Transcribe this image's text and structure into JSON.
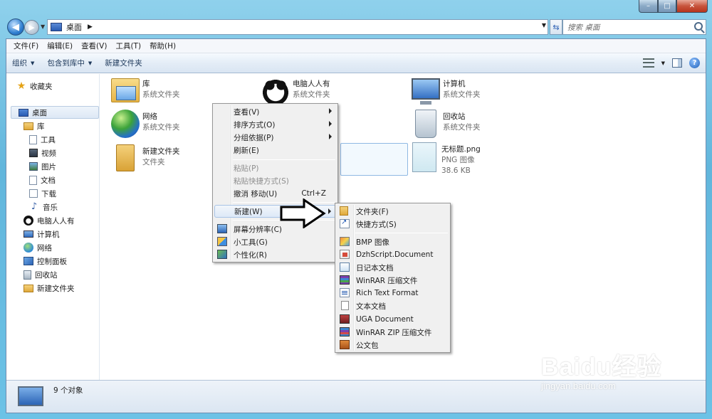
{
  "window": {
    "caption_buttons": {
      "min": "–",
      "max": "□",
      "close": "✕"
    }
  },
  "address": {
    "path": "桌面",
    "search_placeholder": "搜索 桌面"
  },
  "menubar": [
    "文件(F)",
    "编辑(E)",
    "查看(V)",
    "工具(T)",
    "帮助(H)"
  ],
  "toolbar": {
    "organize": "组织",
    "include": "包含到库中",
    "new_folder": "新建文件夹"
  },
  "navpane": {
    "favorites": "收藏夹",
    "desktop": "桌面",
    "library": "库",
    "tools": "工具",
    "video": "视频",
    "pictures": "图片",
    "documents": "文档",
    "downloads": "下载",
    "music": "音乐",
    "user": "电脑人人有",
    "computer": "计算机",
    "network": "网络",
    "control_panel": "控制面板",
    "recycle_bin": "回收站",
    "new_folder": "新建文件夹"
  },
  "items": {
    "library": {
      "name": "库",
      "type": "系统文件夹"
    },
    "user": {
      "name": "电脑人人有",
      "type": "系统文件夹"
    },
    "computer": {
      "name": "计算机",
      "type": "系统文件夹"
    },
    "network": {
      "name": "网络",
      "type": "系统文件夹"
    },
    "recycle": {
      "name": "回收站",
      "type": "系统文件夹"
    },
    "newfolder": {
      "name": "新建文件夹",
      "type": "文件夹"
    },
    "png": {
      "name": "无标题.png",
      "type": "PNG 图像",
      "size": "38.6 KB"
    }
  },
  "status": {
    "count": "9 个对象"
  },
  "context_menu": {
    "view": "查看(V)",
    "sort": "排序方式(O)",
    "group": "分组依据(P)",
    "refresh": "刷新(E)",
    "paste": "粘贴(P)",
    "paste_shortcut": "粘贴快捷方式(S)",
    "undo": "撤消 移动(U)",
    "undo_shortcut": "Ctrl+Z",
    "new": "新建(W)",
    "resolution": "屏幕分辨率(C)",
    "gadgets": "小工具(G)",
    "personalize": "个性化(R)"
  },
  "new_submenu": {
    "folder": "文件夹(F)",
    "shortcut": "快捷方式(S)",
    "bmp": "BMP 图像",
    "dzh": "DzhScript.Document",
    "journal": "日记本文档",
    "winrar": "WinRAR 压缩文件",
    "rtf": "Rich Text Format",
    "txt": "文本文档",
    "uga": "UGA Document",
    "winrar_zip": "WinRAR ZIP 压缩文件",
    "briefcase": "公文包"
  },
  "watermark": {
    "logo": "Baidu经验",
    "url": "jingyan.baidu.com"
  }
}
